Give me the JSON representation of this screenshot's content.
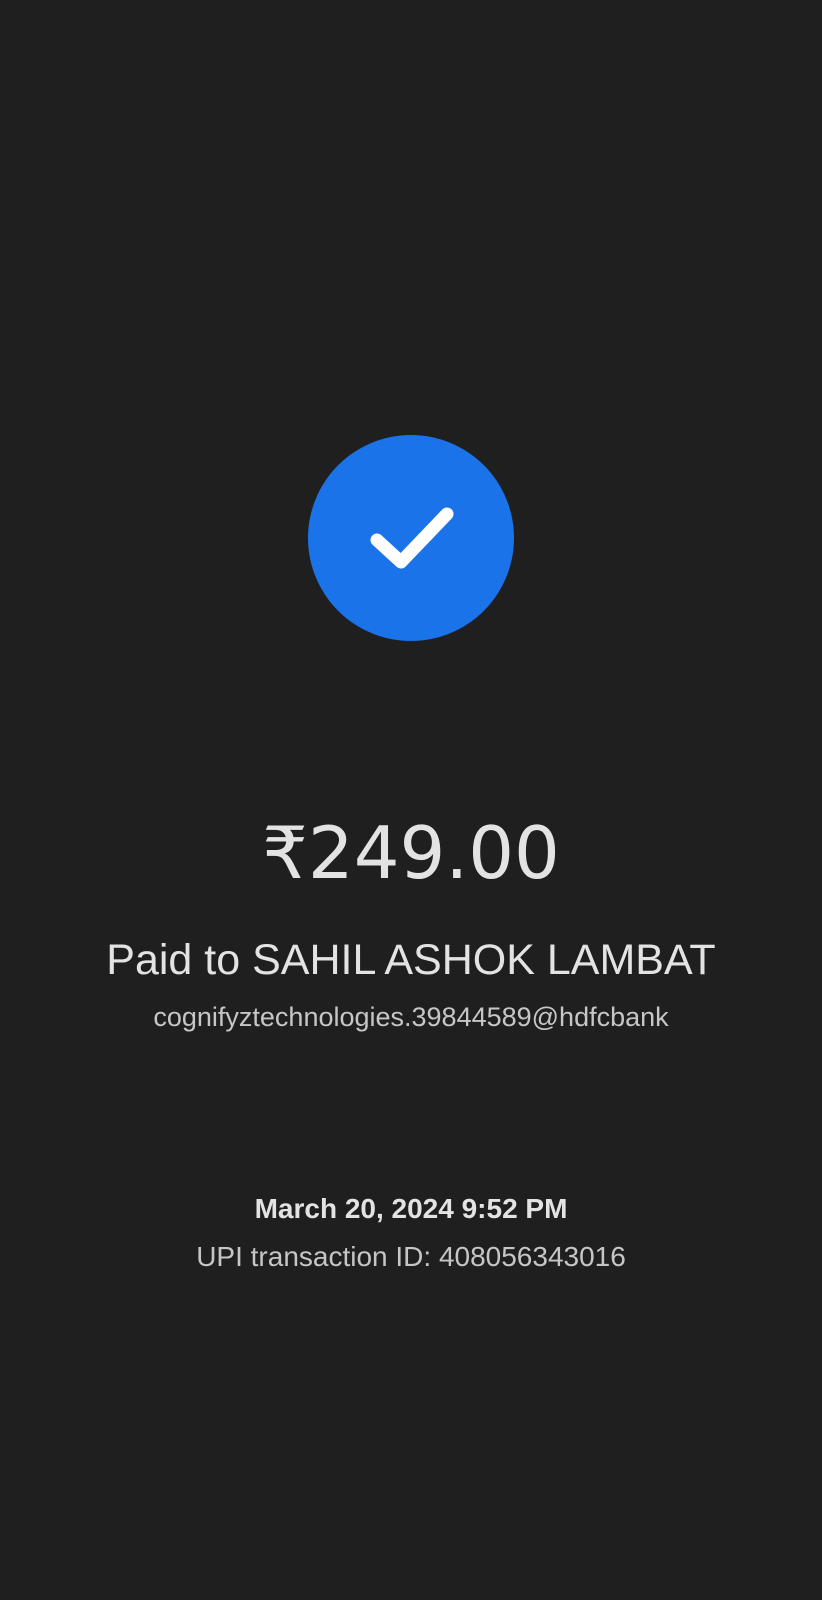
{
  "status": {
    "icon": "check-icon",
    "accent_color": "#1a73e8"
  },
  "payment": {
    "amount": "₹249.00",
    "paid_to": "Paid to SAHIL ASHOK LAMBAT",
    "upi_id": "cognifyztechnologies.39844589@hdfcbank"
  },
  "details": {
    "datetime": "March 20, 2024 9:52 PM",
    "transaction_id": "UPI transaction ID: 408056343016"
  }
}
